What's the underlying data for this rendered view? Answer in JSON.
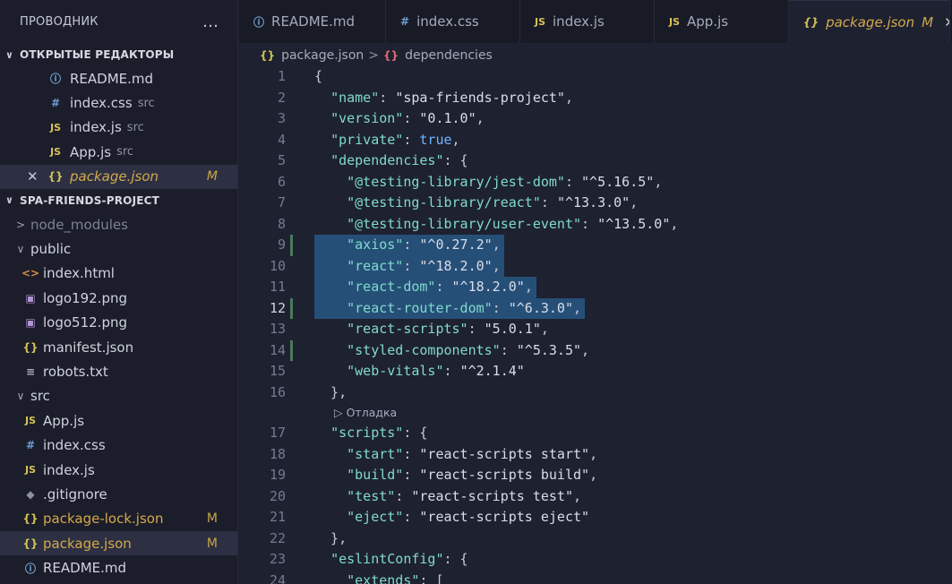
{
  "sidebar": {
    "title": "ПРОВОДНИК",
    "more_icon": "…",
    "open_editors": {
      "label": "ОТКРЫТЫЕ РЕДАКТОРЫ",
      "items": [
        {
          "icon": "info-icon",
          "glyph": "ⓘ",
          "name": "README.md",
          "dir": ""
        },
        {
          "icon": "hash-icon",
          "glyph": "#",
          "name": "index.css",
          "dir": "src"
        },
        {
          "icon": "js-icon",
          "glyph": "JS",
          "name": "index.js",
          "dir": "src"
        },
        {
          "icon": "js-icon",
          "glyph": "JS",
          "name": "App.js",
          "dir": "src"
        },
        {
          "icon": "json-icon",
          "glyph": "{}",
          "name": "package.json",
          "dir": "",
          "badge": "M",
          "close": "✕"
        }
      ]
    },
    "project": {
      "label": "SPA-FRIENDS-PROJECT",
      "tree": [
        {
          "type": "folder",
          "name": "node_modules",
          "state": "collapsed"
        },
        {
          "type": "folder",
          "name": "public",
          "state": "expanded"
        },
        {
          "type": "file",
          "icon": "html-icon",
          "glyph": "<>",
          "name": "index.html"
        },
        {
          "type": "file",
          "icon": "image-icon",
          "glyph": "▣",
          "name": "logo192.png"
        },
        {
          "type": "file",
          "icon": "image-icon",
          "glyph": "▣",
          "name": "logo512.png"
        },
        {
          "type": "file",
          "icon": "json-icon",
          "glyph": "{}",
          "name": "manifest.json"
        },
        {
          "type": "file",
          "icon": "text-icon",
          "glyph": "≡",
          "name": "robots.txt"
        },
        {
          "type": "folder",
          "name": "src",
          "state": "expanded"
        },
        {
          "type": "file",
          "icon": "js-icon",
          "glyph": "JS",
          "name": "App.js"
        },
        {
          "type": "file",
          "icon": "hash-icon",
          "glyph": "#",
          "name": "index.css"
        },
        {
          "type": "file",
          "icon": "js-icon",
          "glyph": "JS",
          "name": "index.js"
        },
        {
          "type": "file",
          "icon": "git-icon",
          "glyph": "◆",
          "name": ".gitignore"
        },
        {
          "type": "file",
          "icon": "json-icon",
          "glyph": "{}",
          "name": "package-lock.json",
          "badge": "M"
        },
        {
          "type": "file",
          "icon": "json-icon",
          "glyph": "{}",
          "name": "package.json",
          "badge": "M"
        },
        {
          "type": "file",
          "icon": "info-icon",
          "glyph": "ⓘ",
          "name": "README.md"
        }
      ]
    }
  },
  "tabs": [
    {
      "icon": "info-icon",
      "glyph": "ⓘ",
      "label": "README.md"
    },
    {
      "icon": "hash-icon",
      "glyph": "#",
      "label": "index.css"
    },
    {
      "icon": "js-icon",
      "glyph": "JS",
      "label": "index.js"
    },
    {
      "icon": "js-icon",
      "glyph": "JS",
      "label": "App.js"
    },
    {
      "icon": "json-icon",
      "glyph": "{}",
      "label": "package.json",
      "badge": "M",
      "close": "✕",
      "active": true
    }
  ],
  "breadcrumb": {
    "file_glyph": "{}",
    "file": "package.json",
    "separator": ">",
    "symbol_glyph": "{}",
    "symbol": "dependencies"
  },
  "codelens": "▷ Отладка",
  "code_lines": [
    {
      "n": "1",
      "text": "{"
    },
    {
      "n": "2",
      "text": "  \"name\": \"spa-friends-project\","
    },
    {
      "n": "3",
      "text": "  \"version\": \"0.1.0\","
    },
    {
      "n": "4",
      "text": "  \"private\": true,"
    },
    {
      "n": "5",
      "text": "  \"dependencies\": {"
    },
    {
      "n": "6",
      "text": "    \"@testing-library/jest-dom\": \"^5.16.5\","
    },
    {
      "n": "7",
      "text": "    \"@testing-library/react\": \"^13.3.0\","
    },
    {
      "n": "8",
      "text": "    \"@testing-library/user-event\": \"^13.5.0\","
    },
    {
      "n": "9",
      "text": "    \"axios\": \"^0.27.2\","
    },
    {
      "n": "10",
      "text": "    \"react\": \"^18.2.0\","
    },
    {
      "n": "11",
      "text": "    \"react-dom\": \"^18.2.0\","
    },
    {
      "n": "12",
      "text": "    \"react-router-dom\": \"^6.3.0\","
    },
    {
      "n": "13",
      "text": "    \"react-scripts\": \"5.0.1\","
    },
    {
      "n": "14",
      "text": "    \"styled-components\": \"^5.3.5\","
    },
    {
      "n": "15",
      "text": "    \"web-vitals\": \"^2.1.4\""
    },
    {
      "n": "16",
      "text": "  },"
    },
    {
      "n": "17",
      "text": "  \"scripts\": {"
    },
    {
      "n": "18",
      "text": "    \"start\": \"react-scripts start\","
    },
    {
      "n": "19",
      "text": "    \"build\": \"react-scripts build\","
    },
    {
      "n": "20",
      "text": "    \"test\": \"react-scripts test\","
    },
    {
      "n": "21",
      "text": "    \"eject\": \"react-scripts eject\""
    },
    {
      "n": "22",
      "text": "  },"
    },
    {
      "n": "23",
      "text": "  \"eslintConfig\": {"
    },
    {
      "n": "24",
      "text": "    \"extends\": ["
    }
  ],
  "colors": {
    "selection": "#264f78",
    "modified": "#d4a94c",
    "key": "#7fdbca",
    "bool": "#6fb3ff"
  }
}
